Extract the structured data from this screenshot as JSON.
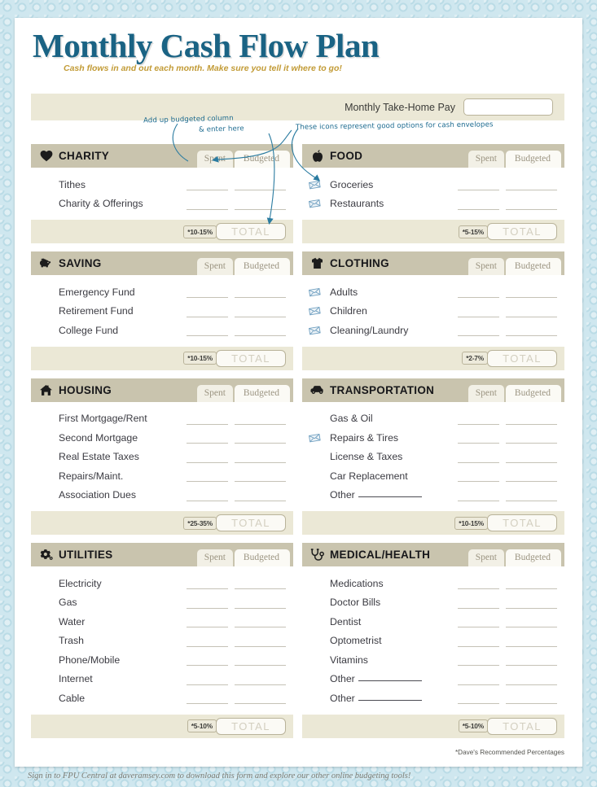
{
  "header": {
    "title": "Monthly Cash Flow Plan",
    "subtitle": "Cash flows in and out each month. Make sure you tell it where to go!"
  },
  "takehome": {
    "label": "Monthly Take-Home Pay",
    "value": "",
    "placeholder": ""
  },
  "annotations": {
    "a": "Add up budgeted column",
    "b": "& enter here",
    "c": "These icons represent good options for cash envelopes"
  },
  "columns": {
    "spent_label": "Spent",
    "budgeted_label": "Budgeted",
    "total_label": "TOTAL"
  },
  "colors": {
    "title": "#1a6384",
    "subtitle": "#c29b36",
    "header_bar": "#c9c4ae",
    "footer_bar": "#ebe8d6",
    "annotation": "#1d6b90",
    "envelope": "#6f9fc0",
    "page_bg": "#cfe7ef"
  },
  "sections": [
    {
      "id": "charity",
      "title": "CHARITY",
      "icon": "heart-icon",
      "percent": "*10-15%",
      "column": "left",
      "items": [
        {
          "label": "Tithes",
          "envelope": false,
          "blank": false
        },
        {
          "label": "Charity & Offerings",
          "envelope": false,
          "blank": false
        }
      ]
    },
    {
      "id": "saving",
      "title": "SAVING",
      "icon": "piggy-bank-icon",
      "percent": "*10-15%",
      "column": "left",
      "items": [
        {
          "label": "Emergency Fund",
          "envelope": false,
          "blank": false
        },
        {
          "label": "Retirement Fund",
          "envelope": false,
          "blank": false
        },
        {
          "label": "College Fund",
          "envelope": false,
          "blank": false
        }
      ]
    },
    {
      "id": "housing",
      "title": "HOUSING",
      "icon": "house-icon",
      "percent": "*25-35%",
      "column": "left",
      "items": [
        {
          "label": "First Mortgage/Rent",
          "envelope": false,
          "blank": false
        },
        {
          "label": "Second Mortgage",
          "envelope": false,
          "blank": false
        },
        {
          "label": "Real Estate Taxes",
          "envelope": false,
          "blank": false
        },
        {
          "label": "Repairs/Maint.",
          "envelope": false,
          "blank": false
        },
        {
          "label": "Association Dues",
          "envelope": false,
          "blank": false
        }
      ]
    },
    {
      "id": "utilities",
      "title": "UTILITIES",
      "icon": "gear-icon",
      "percent": "*5-10%",
      "column": "left",
      "items": [
        {
          "label": "Electricity",
          "envelope": false,
          "blank": false
        },
        {
          "label": "Gas",
          "envelope": false,
          "blank": false
        },
        {
          "label": "Water",
          "envelope": false,
          "blank": false
        },
        {
          "label": "Trash",
          "envelope": false,
          "blank": false
        },
        {
          "label": "Phone/Mobile",
          "envelope": false,
          "blank": false
        },
        {
          "label": "Internet",
          "envelope": false,
          "blank": false
        },
        {
          "label": "Cable",
          "envelope": false,
          "blank": false
        }
      ]
    },
    {
      "id": "food",
      "title": "FOOD",
      "icon": "apple-icon",
      "percent": "*5-15%",
      "column": "right",
      "items": [
        {
          "label": "Groceries",
          "envelope": true,
          "blank": false
        },
        {
          "label": "Restaurants",
          "envelope": true,
          "blank": false
        }
      ]
    },
    {
      "id": "clothing",
      "title": "CLOTHING",
      "icon": "tshirt-icon",
      "percent": "*2-7%",
      "column": "right",
      "items": [
        {
          "label": "Adults",
          "envelope": true,
          "blank": false
        },
        {
          "label": "Children",
          "envelope": true,
          "blank": false
        },
        {
          "label": "Cleaning/Laundry",
          "envelope": true,
          "blank": false
        }
      ]
    },
    {
      "id": "transportation",
      "title": "TRANSPORTATION",
      "icon": "car-icon",
      "percent": "*10-15%",
      "column": "right",
      "items": [
        {
          "label": "Gas & Oil",
          "envelope": false,
          "blank": false
        },
        {
          "label": "Repairs & Tires",
          "envelope": true,
          "blank": false
        },
        {
          "label": "License & Taxes",
          "envelope": false,
          "blank": false
        },
        {
          "label": "Car Replacement",
          "envelope": false,
          "blank": false
        },
        {
          "label": "Other",
          "envelope": false,
          "blank": true
        }
      ]
    },
    {
      "id": "medical-health",
      "title": "MEDICAL/HEALTH",
      "icon": "stethoscope-icon",
      "percent": "*5-10%",
      "column": "right",
      "items": [
        {
          "label": "Medications",
          "envelope": false,
          "blank": false
        },
        {
          "label": "Doctor Bills",
          "envelope": false,
          "blank": false
        },
        {
          "label": "Dentist",
          "envelope": false,
          "blank": false
        },
        {
          "label": "Optometrist",
          "envelope": false,
          "blank": false
        },
        {
          "label": "Vitamins",
          "envelope": false,
          "blank": false
        },
        {
          "label": "Other",
          "envelope": false,
          "blank": true
        },
        {
          "label": "Other",
          "envelope": false,
          "blank": true
        }
      ]
    }
  ],
  "footer": {
    "recommended_note": "*Dave's Recommended Percentages",
    "signin_note": "Sign in to FPU Central at daveramsey.com to download this form and explore our other online budgeting tools!"
  }
}
